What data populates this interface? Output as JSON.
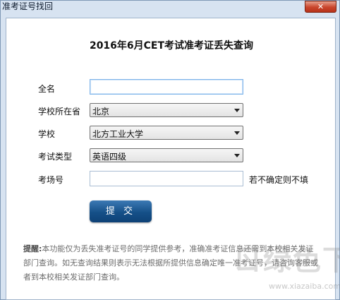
{
  "window": {
    "title": "准考证号找回",
    "close_glyph": "✕"
  },
  "form": {
    "heading": "2016年6月CET考试准考证丢失查询",
    "fullname": {
      "label": "全名",
      "value": ""
    },
    "province": {
      "label": "学校所在省",
      "selected": "北京"
    },
    "school": {
      "label": "学校",
      "selected": "北方工业大学"
    },
    "exam_type": {
      "label": "考试类型",
      "selected": "英语四级"
    },
    "exam_room": {
      "label": "考场号",
      "value": "",
      "hint": "若不确定则不填"
    },
    "submit_label": "提 交"
  },
  "notice": {
    "prefix": "提醒:",
    "text": "本功能仅为丢失准考证号的同学提供参考，准确准考证信息还需到本校相关发证部门查询。如无查询结果则表示无法根据所提供信息确定唯一准考证号，请咨询客服或者到本校相关发证部门查询。"
  },
  "watermark": {
    "text": "ㄖ绿色下载吧",
    "url": "www.xiazaiba.com"
  }
}
